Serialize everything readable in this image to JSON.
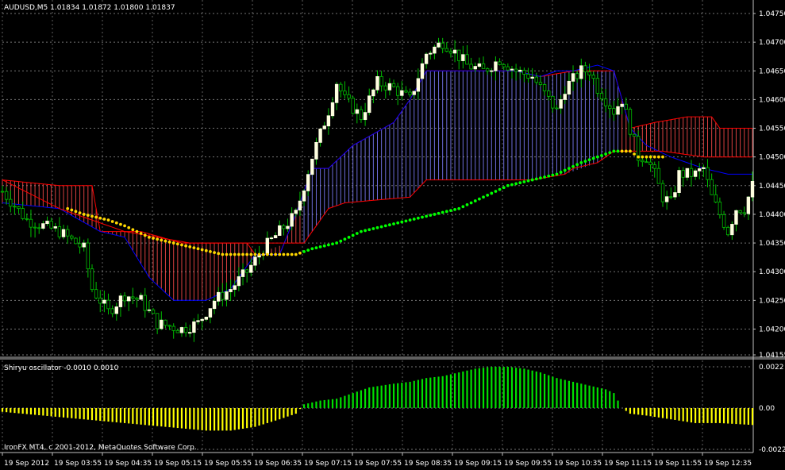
{
  "header": {
    "symbol_info": "AUDUSD,M5  1.01834 1.01872 1.01800 1.01837",
    "oscillator_info": "Shiryu oscillator -0.0010 0.0010",
    "copyright": "IronFX MT4, c 2001-2012, MetaQuotes Software Corp."
  },
  "colors": {
    "background": "#000000",
    "grid": "#c0c0c0",
    "bull_candle": "#ffffe0",
    "bear_candle": "#000000",
    "wick": "#00c000",
    "tenkan": "#ff0000",
    "kijun": "#0000ff",
    "cloud_bull": "#7f7fff",
    "cloud_bear": "#ff4c4c",
    "dots_bear": "#ffd700",
    "dots_bull": "#00ff00",
    "osc_pos": "#00e000",
    "osc_neg": "#ffff00"
  },
  "chart_data": [
    {
      "type": "candlestick",
      "title": "AUDUSD,M5",
      "ylim": [
        1.04155,
        1.0475
      ],
      "y_ticks": [
        "1.04750",
        "1.04700",
        "1.04650",
        "1.04600",
        "1.04550",
        "1.04500",
        "1.04450",
        "1.04400",
        "1.04350",
        "1.04300",
        "1.04250",
        "1.04200",
        "1.04155"
      ],
      "x_ticks": [
        "19 Sep 2012",
        "19 Sep 03:55",
        "19 Sep 04:35",
        "19 Sep 05:15",
        "19 Sep 05:55",
        "19 Sep 06:35",
        "19 Sep 07:15",
        "19 Sep 07:55",
        "19 Sep 08:35",
        "19 Sep 09:15",
        "19 Sep 09:55",
        "19 Sep 10:35",
        "19 Sep 11:15",
        "19 Sep 11:55",
        "19 Sep 12:35"
      ],
      "grid": true,
      "close_path": [
        [
          0,
          1.0444
        ],
        [
          6,
          1.0439
        ],
        [
          14,
          1.0437
        ],
        [
          20,
          1.0434
        ],
        [
          22,
          1.0427
        ],
        [
          26,
          1.0423
        ],
        [
          30,
          1.0426
        ],
        [
          34,
          1.0425
        ],
        [
          38,
          1.0421
        ],
        [
          44,
          1.042
        ],
        [
          48,
          1.0421
        ],
        [
          52,
          1.0425
        ],
        [
          56,
          1.0427
        ],
        [
          60,
          1.043
        ],
        [
          64,
          1.0434
        ],
        [
          68,
          1.0437
        ],
        [
          72,
          1.044
        ],
        [
          76,
          1.045
        ],
        [
          80,
          1.0458
        ],
        [
          82,
          1.0463
        ],
        [
          84,
          1.046
        ],
        [
          88,
          1.0457
        ],
        [
          92,
          1.0463
        ],
        [
          96,
          1.0462
        ],
        [
          100,
          1.046
        ],
        [
          104,
          1.0468
        ],
        [
          108,
          1.047
        ],
        [
          110,
          1.0469
        ],
        [
          114,
          1.0466
        ],
        [
          118,
          1.0465
        ],
        [
          122,
          1.0467
        ],
        [
          126,
          1.0465
        ],
        [
          130,
          1.0464
        ],
        [
          134,
          1.046
        ],
        [
          136,
          1.0458
        ],
        [
          138,
          1.0462
        ],
        [
          142,
          1.0465
        ],
        [
          144,
          1.0465
        ],
        [
          146,
          1.0462
        ],
        [
          150,
          1.0458
        ],
        [
          152,
          1.046
        ],
        [
          154,
          1.0455
        ],
        [
          156,
          1.045
        ],
        [
          158,
          1.045
        ],
        [
          160,
          1.0447
        ],
        [
          162,
          1.0443
        ],
        [
          164,
          1.0442
        ],
        [
          166,
          1.0447
        ],
        [
          170,
          1.0447
        ],
        [
          172,
          1.0448
        ],
        [
          174,
          1.0443
        ],
        [
          176,
          1.044
        ],
        [
          178,
          1.0437
        ],
        [
          180,
          1.0441
        ],
        [
          182,
          1.0441
        ],
        [
          184,
          1.0445
        ]
      ],
      "kijun_path": [
        [
          0,
          1.0442
        ],
        [
          14,
          1.0441
        ],
        [
          24,
          1.0437
        ],
        [
          30,
          1.0436
        ],
        [
          36,
          1.0429
        ],
        [
          42,
          1.0425
        ],
        [
          50,
          1.0425
        ],
        [
          56,
          1.0427
        ],
        [
          62,
          1.0433
        ],
        [
          68,
          1.0433
        ],
        [
          72,
          1.044
        ],
        [
          76,
          1.0448
        ],
        [
          80,
          1.0448
        ],
        [
          86,
          1.0452
        ],
        [
          96,
          1.0456
        ],
        [
          100,
          1.046
        ],
        [
          104,
          1.0465
        ],
        [
          110,
          1.0465
        ],
        [
          116,
          1.0465
        ],
        [
          126,
          1.0465
        ],
        [
          132,
          1.0464
        ],
        [
          136,
          1.0465
        ],
        [
          140,
          1.0465
        ],
        [
          146,
          1.0466
        ],
        [
          150,
          1.0465
        ],
        [
          154,
          1.0455
        ],
        [
          158,
          1.0452
        ],
        [
          164,
          1.045
        ],
        [
          172,
          1.0448
        ],
        [
          178,
          1.0447
        ],
        [
          184,
          1.0447
        ]
      ],
      "tenkan_path": [
        [
          0,
          1.0446
        ],
        [
          14,
          1.0441
        ],
        [
          30,
          1.0437
        ],
        [
          46,
          1.0435
        ],
        [
          60,
          1.0435
        ],
        [
          70,
          1.0435
        ],
        [
          74,
          1.0435
        ],
        [
          80,
          1.0441
        ],
        [
          84,
          1.0442
        ],
        [
          100,
          1.0443
        ],
        [
          104,
          1.0446
        ],
        [
          106,
          1.0446
        ],
        [
          120,
          1.0446
        ],
        [
          130,
          1.0446
        ],
        [
          138,
          1.0447
        ],
        [
          140,
          1.0448
        ],
        [
          146,
          1.0449
        ],
        [
          150,
          1.0451
        ],
        [
          156,
          1.0451
        ],
        [
          162,
          1.0451
        ],
        [
          172,
          1.045
        ],
        [
          184,
          1.045
        ]
      ],
      "cloud_upper_path": [
        [
          0,
          1.0446
        ],
        [
          14,
          1.0445
        ],
        [
          22,
          1.0445
        ],
        [
          24,
          1.0437
        ],
        [
          34,
          1.0437
        ],
        [
          44,
          1.0435
        ],
        [
          60,
          1.0435
        ],
        [
          62,
          1.0433
        ],
        [
          68,
          1.0433
        ],
        [
          72,
          1.044
        ],
        [
          76,
          1.0448
        ],
        [
          80,
          1.0448
        ],
        [
          86,
          1.0452
        ],
        [
          96,
          1.0456
        ],
        [
          100,
          1.046
        ],
        [
          104,
          1.0465
        ],
        [
          126,
          1.0465
        ],
        [
          132,
          1.0464
        ],
        [
          140,
          1.0465
        ],
        [
          150,
          1.0465
        ],
        [
          154,
          1.0455
        ],
        [
          160,
          1.0456
        ],
        [
          168,
          1.0457
        ],
        [
          174,
          1.0457
        ],
        [
          176,
          1.0455
        ],
        [
          184,
          1.0455
        ]
      ],
      "cloud_lower_path": [
        [
          0,
          1.0442
        ],
        [
          14,
          1.0441
        ],
        [
          24,
          1.0437
        ],
        [
          30,
          1.0436
        ],
        [
          36,
          1.0429
        ],
        [
          42,
          1.0425
        ],
        [
          50,
          1.0425
        ],
        [
          56,
          1.0427
        ],
        [
          62,
          1.0433
        ],
        [
          70,
          1.0435
        ],
        [
          74,
          1.0435
        ],
        [
          80,
          1.0441
        ],
        [
          84,
          1.0442
        ],
        [
          100,
          1.0443
        ],
        [
          104,
          1.0446
        ],
        [
          120,
          1.0446
        ],
        [
          130,
          1.0446
        ],
        [
          138,
          1.0447
        ],
        [
          146,
          1.0449
        ],
        [
          150,
          1.0451
        ],
        [
          156,
          1.0451
        ],
        [
          162,
          1.0451
        ],
        [
          172,
          1.045
        ],
        [
          184,
          1.045
        ]
      ],
      "cloud_color_switch": [
        {
          "from": 0,
          "to": 62,
          "color": "bear"
        },
        {
          "from": 62,
          "to": 74,
          "color": "bear"
        },
        {
          "from": 74,
          "to": 152,
          "color": "bull"
        },
        {
          "from": 152,
          "to": 184,
          "color": "bear"
        }
      ],
      "dots_path": [
        [
          16,
          1.0441
        ],
        [
          20,
          1.044
        ],
        [
          26,
          1.0439
        ],
        [
          30,
          1.0438
        ],
        [
          36,
          1.0436
        ],
        [
          42,
          1.0435
        ],
        [
          48,
          1.0434
        ],
        [
          54,
          1.0433
        ],
        [
          60,
          1.0433
        ],
        [
          66,
          1.0433
        ],
        [
          72,
          1.0433
        ],
        [
          76,
          1.0434
        ],
        [
          82,
          1.0435
        ],
        [
          88,
          1.0437
        ],
        [
          94,
          1.0438
        ],
        [
          100,
          1.0439
        ],
        [
          106,
          1.044
        ],
        [
          112,
          1.0441
        ],
        [
          118,
          1.0443
        ],
        [
          124,
          1.0445
        ],
        [
          130,
          1.0446
        ],
        [
          136,
          1.0447
        ],
        [
          142,
          1.0449
        ],
        [
          146,
          1.045
        ],
        [
          150,
          1.0451
        ],
        [
          152,
          1.0451
        ],
        [
          154,
          1.0451
        ],
        [
          156,
          1.045
        ],
        [
          160,
          1.045
        ],
        [
          162,
          1.045
        ]
      ],
      "dots_bull_range": [
        74,
        152
      ]
    },
    {
      "type": "bar",
      "title": "Shiryu oscillator",
      "ylim": [
        -0.0022,
        0.0022
      ],
      "y_ticks": [
        "0.0022",
        "0.00",
        "-0.0022"
      ],
      "values_path": [
        [
          0,
          -0.0002
        ],
        [
          10,
          -0.0004
        ],
        [
          20,
          -0.0006
        ],
        [
          30,
          -0.0008
        ],
        [
          40,
          -0.001
        ],
        [
          50,
          -0.0012
        ],
        [
          56,
          -0.0012
        ],
        [
          62,
          -0.001
        ],
        [
          68,
          -0.0006
        ],
        [
          72,
          -0.0003
        ],
        [
          74,
          0.0002
        ],
        [
          78,
          0.0004
        ],
        [
          82,
          0.0005
        ],
        [
          86,
          0.0008
        ],
        [
          90,
          0.0011
        ],
        [
          96,
          0.0013
        ],
        [
          100,
          0.0014
        ],
        [
          104,
          0.0016
        ],
        [
          108,
          0.0017
        ],
        [
          112,
          0.0019
        ],
        [
          116,
          0.0021
        ],
        [
          120,
          0.0022
        ],
        [
          124,
          0.0022
        ],
        [
          128,
          0.0021
        ],
        [
          132,
          0.0019
        ],
        [
          136,
          0.0016
        ],
        [
          140,
          0.0014
        ],
        [
          144,
          0.0012
        ],
        [
          148,
          0.001
        ],
        [
          150,
          0.0008
        ],
        [
          152,
          0.0
        ],
        [
          154,
          -0.0003
        ],
        [
          158,
          -0.0004
        ],
        [
          164,
          -0.0006
        ],
        [
          170,
          -0.0008
        ],
        [
          176,
          -0.0008
        ],
        [
          184,
          -0.0009
        ]
      ]
    }
  ]
}
